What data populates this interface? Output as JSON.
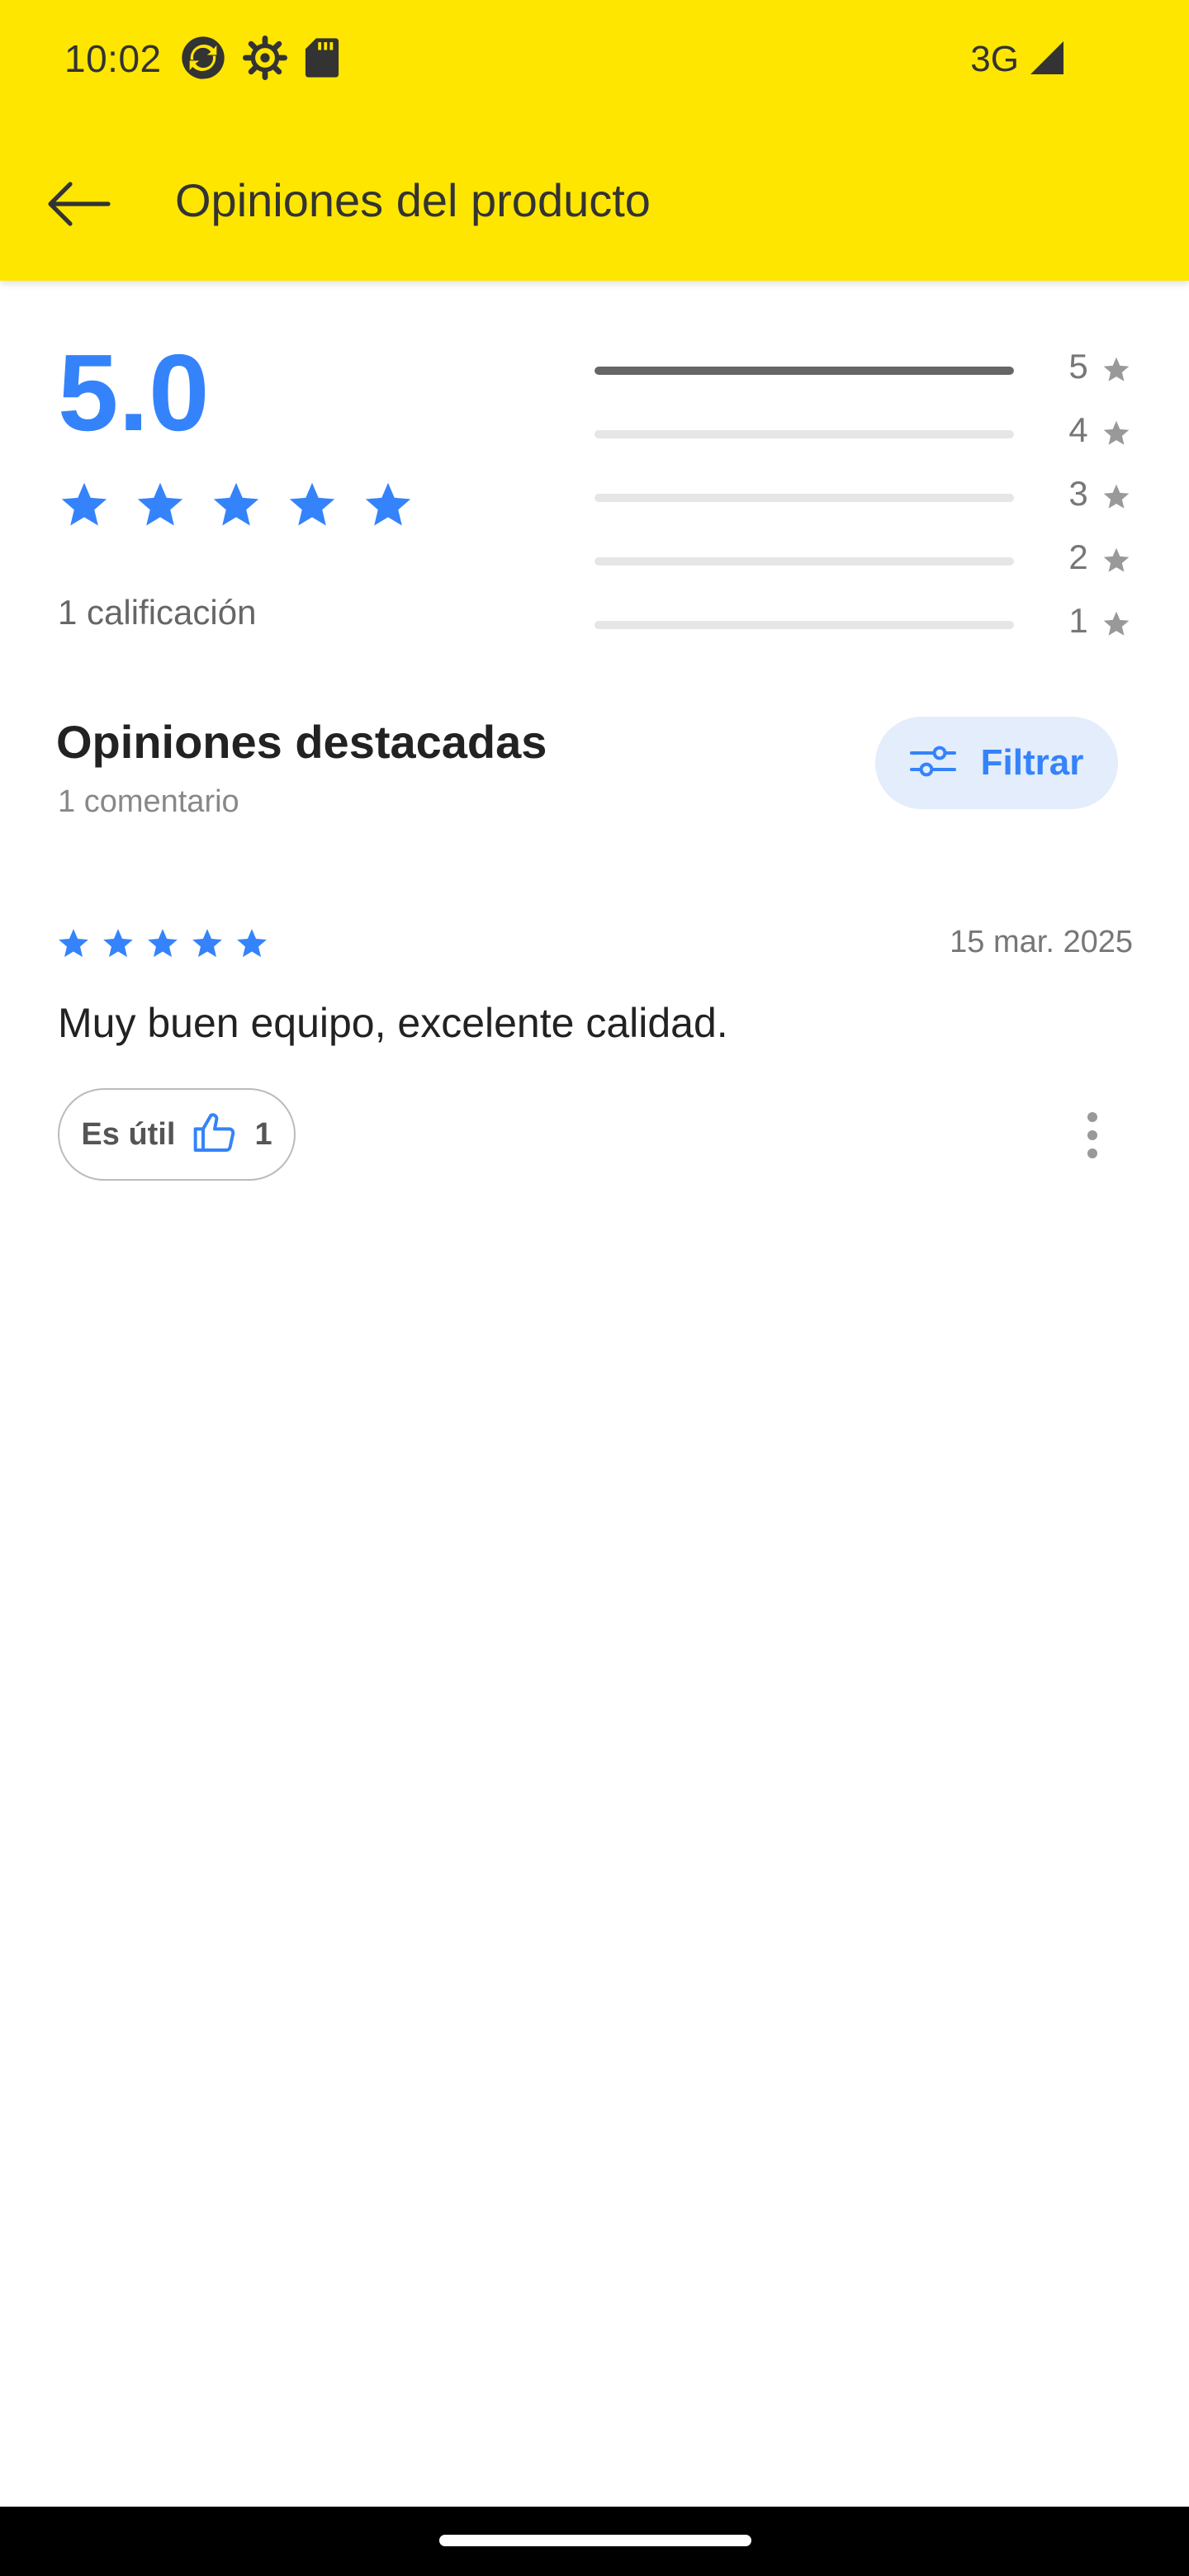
{
  "status_bar": {
    "time": "10:02",
    "network": "3G",
    "icons": [
      "sync-icon",
      "settings-gear-icon",
      "sd-card-icon",
      "signal-icon"
    ]
  },
  "app_bar": {
    "title": "Opiniones del producto",
    "back_icon": "arrow-back-icon"
  },
  "rating_summary": {
    "average": "5.0",
    "stars": 5,
    "count_label": "1 calificación",
    "distribution": [
      {
        "stars": "5",
        "fraction": 1.0
      },
      {
        "stars": "4",
        "fraction": 0.0
      },
      {
        "stars": "3",
        "fraction": 0.0
      },
      {
        "stars": "2",
        "fraction": 0.0
      },
      {
        "stars": "1",
        "fraction": 0.0
      }
    ]
  },
  "featured": {
    "title": "Opiniones destacadas",
    "subtitle": "1 comentario",
    "filter_label": "Filtrar"
  },
  "reviews": [
    {
      "stars": 5,
      "date": "15 mar. 2025",
      "text": "Muy buen equipo, excelente calidad.",
      "helpful_label": "Es útil",
      "helpful_count": "1"
    }
  ],
  "colors": {
    "brand_yellow": "#FFE600",
    "accent_blue": "#3483FA",
    "filter_bg": "#E3EDFB"
  }
}
